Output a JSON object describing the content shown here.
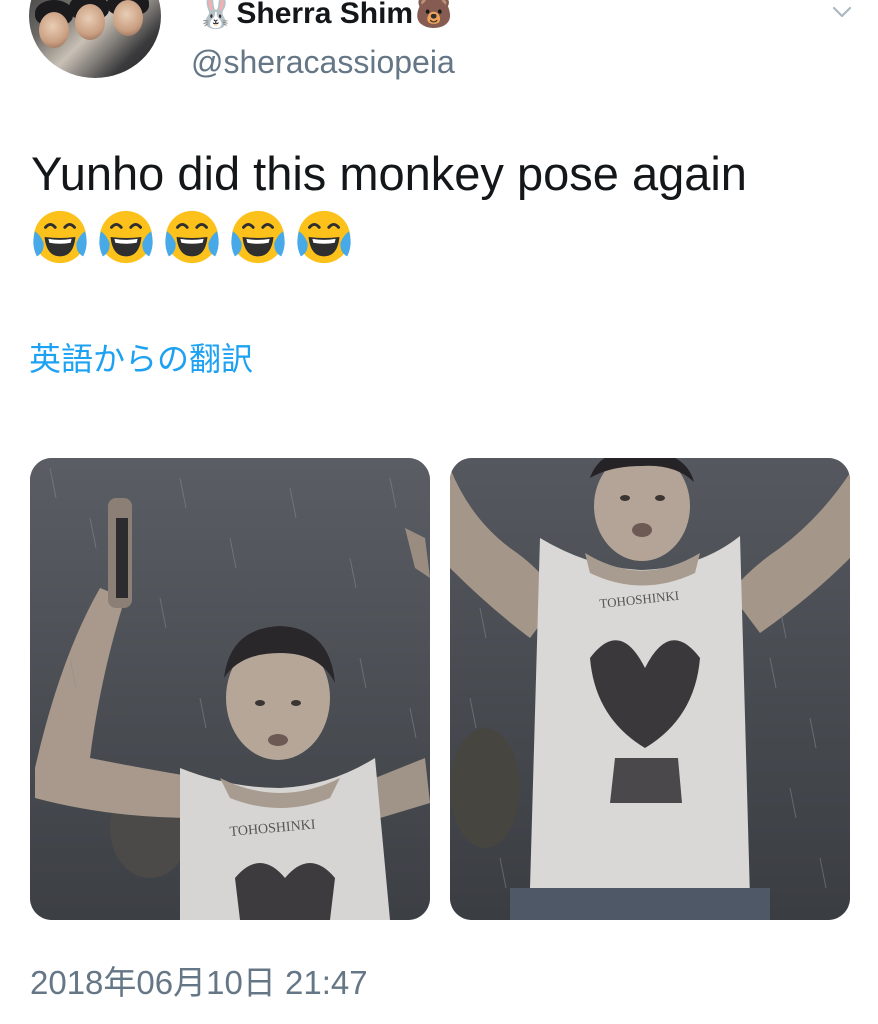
{
  "tweet": {
    "display_name": "Sherra Shim",
    "name_emoji_before": "🐰",
    "name_emoji_after": "🐻",
    "handle": "@sheracassiopeia",
    "text": "Yunho did this monkey pose again",
    "emoji_icon": "face-with-tears-of-joy-icon",
    "emoji_count": 5,
    "translate_link": "英語からの翻訳",
    "timestamp": "2018年06月10日 21:47",
    "photos": [
      {
        "name": "photo-left",
        "depicts": "person in sleeveless shirt raising arms in rain"
      },
      {
        "name": "photo-right",
        "depicts": "person in sleeveless shirt raising arms in rain"
      }
    ]
  },
  "colors": {
    "text": "#14171a",
    "secondary": "#657786",
    "link": "#1da1f2",
    "background": "#ffffff"
  }
}
